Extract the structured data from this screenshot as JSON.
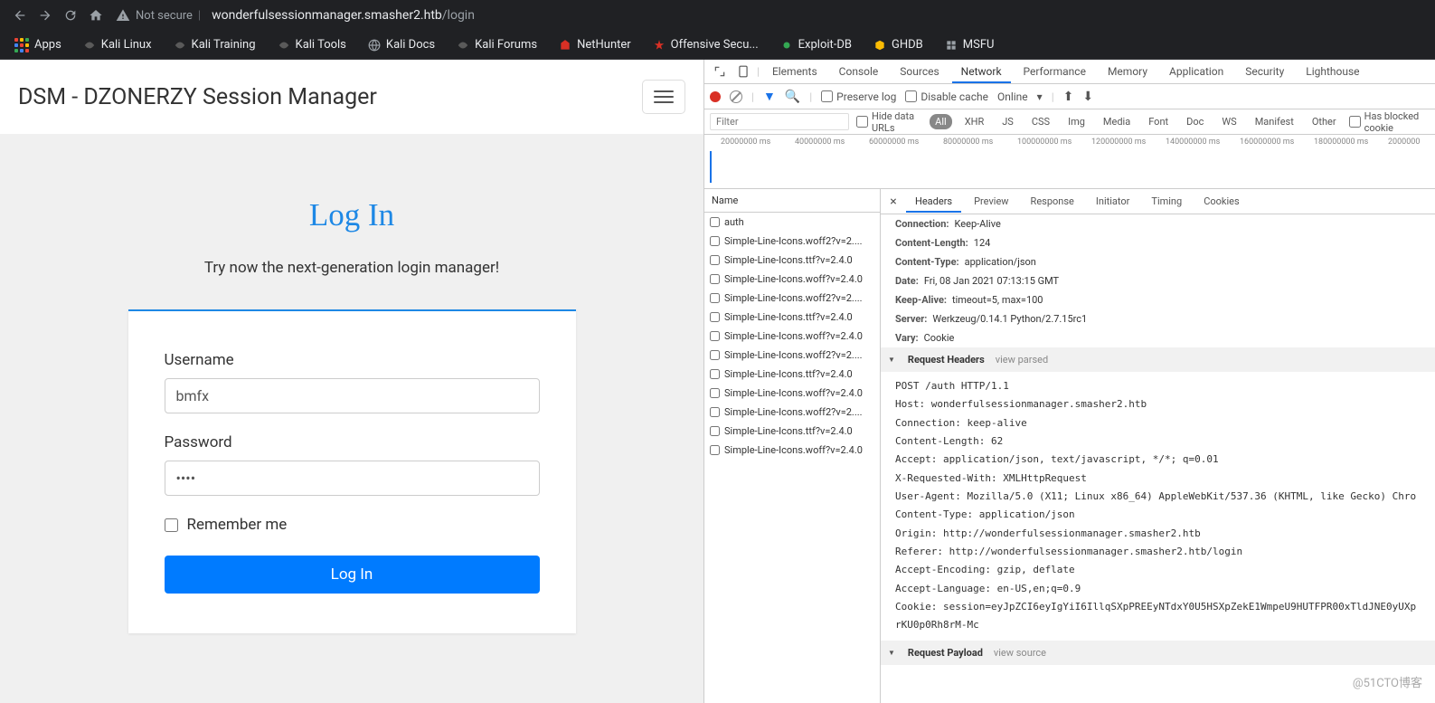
{
  "browser": {
    "security_label": "Not secure",
    "url_host": "wonderfulsessionmanager.smasher2.htb",
    "url_path": "/login"
  },
  "bookmarks": {
    "apps": "Apps",
    "items": [
      "Kali Linux",
      "Kali Training",
      "Kali Tools",
      "Kali Docs",
      "Kali Forums",
      "NetHunter",
      "Offensive Secu...",
      "Exploit-DB",
      "GHDB",
      "MSFU"
    ]
  },
  "page": {
    "title": "DSM - DZONERZY Session Manager",
    "login_heading": "Log In",
    "subtitle": "Try now the next-generation login manager!",
    "username_label": "Username",
    "username_value": "bmfx",
    "password_label": "Password",
    "password_value": "••••",
    "remember": "Remember me",
    "login_button": "Log In"
  },
  "devtools": {
    "tabs": [
      "Elements",
      "Console",
      "Sources",
      "Network",
      "Performance",
      "Memory",
      "Application",
      "Security",
      "Lighthouse"
    ],
    "active_tab": "Network",
    "preserve_log": "Preserve log",
    "disable_cache": "Disable cache",
    "online": "Online",
    "filter_placeholder": "Filter",
    "hide_data_urls": "Hide data URLs",
    "filter_pills": [
      "All",
      "XHR",
      "JS",
      "CSS",
      "Img",
      "Media",
      "Font",
      "Doc",
      "WS",
      "Manifest",
      "Other"
    ],
    "has_blocked": "Has blocked cookie",
    "timeline_ticks": [
      "20000000 ms",
      "40000000 ms",
      "60000000 ms",
      "80000000 ms",
      "100000000 ms",
      "120000000 ms",
      "140000000 ms",
      "160000000 ms",
      "180000000 ms",
      "2000000"
    ],
    "name_header": "Name",
    "requests": [
      "auth",
      "Simple-Line-Icons.woff2?v=2....",
      "Simple-Line-Icons.ttf?v=2.4.0",
      "Simple-Line-Icons.woff?v=2.4.0",
      "Simple-Line-Icons.woff2?v=2....",
      "Simple-Line-Icons.ttf?v=2.4.0",
      "Simple-Line-Icons.woff?v=2.4.0",
      "Simple-Line-Icons.woff2?v=2....",
      "Simple-Line-Icons.ttf?v=2.4.0",
      "Simple-Line-Icons.woff?v=2.4.0",
      "Simple-Line-Icons.woff2?v=2....",
      "Simple-Line-Icons.ttf?v=2.4.0",
      "Simple-Line-Icons.woff?v=2.4.0"
    ],
    "detail_tabs": [
      "Headers",
      "Preview",
      "Response",
      "Initiator",
      "Timing",
      "Cookies"
    ],
    "response_headers": [
      {
        "k": "Connection:",
        "v": "Keep-Alive"
      },
      {
        "k": "Content-Length:",
        "v": "124"
      },
      {
        "k": "Content-Type:",
        "v": "application/json"
      },
      {
        "k": "Date:",
        "v": "Fri, 08 Jan 2021 07:13:15 GMT"
      },
      {
        "k": "Keep-Alive:",
        "v": "timeout=5, max=100"
      },
      {
        "k": "Server:",
        "v": "Werkzeug/0.14.1 Python/2.7.15rc1"
      },
      {
        "k": "Vary:",
        "v": "Cookie"
      }
    ],
    "request_headers_title": "Request Headers",
    "request_payload_title": "Request Payload",
    "view_parsed": "view parsed",
    "view_source": "view source",
    "raw_request": "POST /auth HTTP/1.1\nHost: wonderfulsessionmanager.smasher2.htb\nConnection: keep-alive\nContent-Length: 62\nAccept: application/json, text/javascript, */*; q=0.01\nX-Requested-With: XMLHttpRequest\nUser-Agent: Mozilla/5.0 (X11; Linux x86_64) AppleWebKit/537.36 (KHTML, like Gecko) Chro\nContent-Type: application/json\nOrigin: http://wonderfulsessionmanager.smasher2.htb\nReferer: http://wonderfulsessionmanager.smasher2.htb/login\nAccept-Encoding: gzip, deflate\nAccept-Language: en-US,en;q=0.9\nCookie: session=eyJpZCI6eyIgYiI6IllqSXpPREEyNTdxY0U5HSXpZekE1WmpeU9HUTFPR00xTldJNE0yUXp\nrKU0p0Rh8rM-Mc"
  },
  "watermark": "@51CTO博客"
}
